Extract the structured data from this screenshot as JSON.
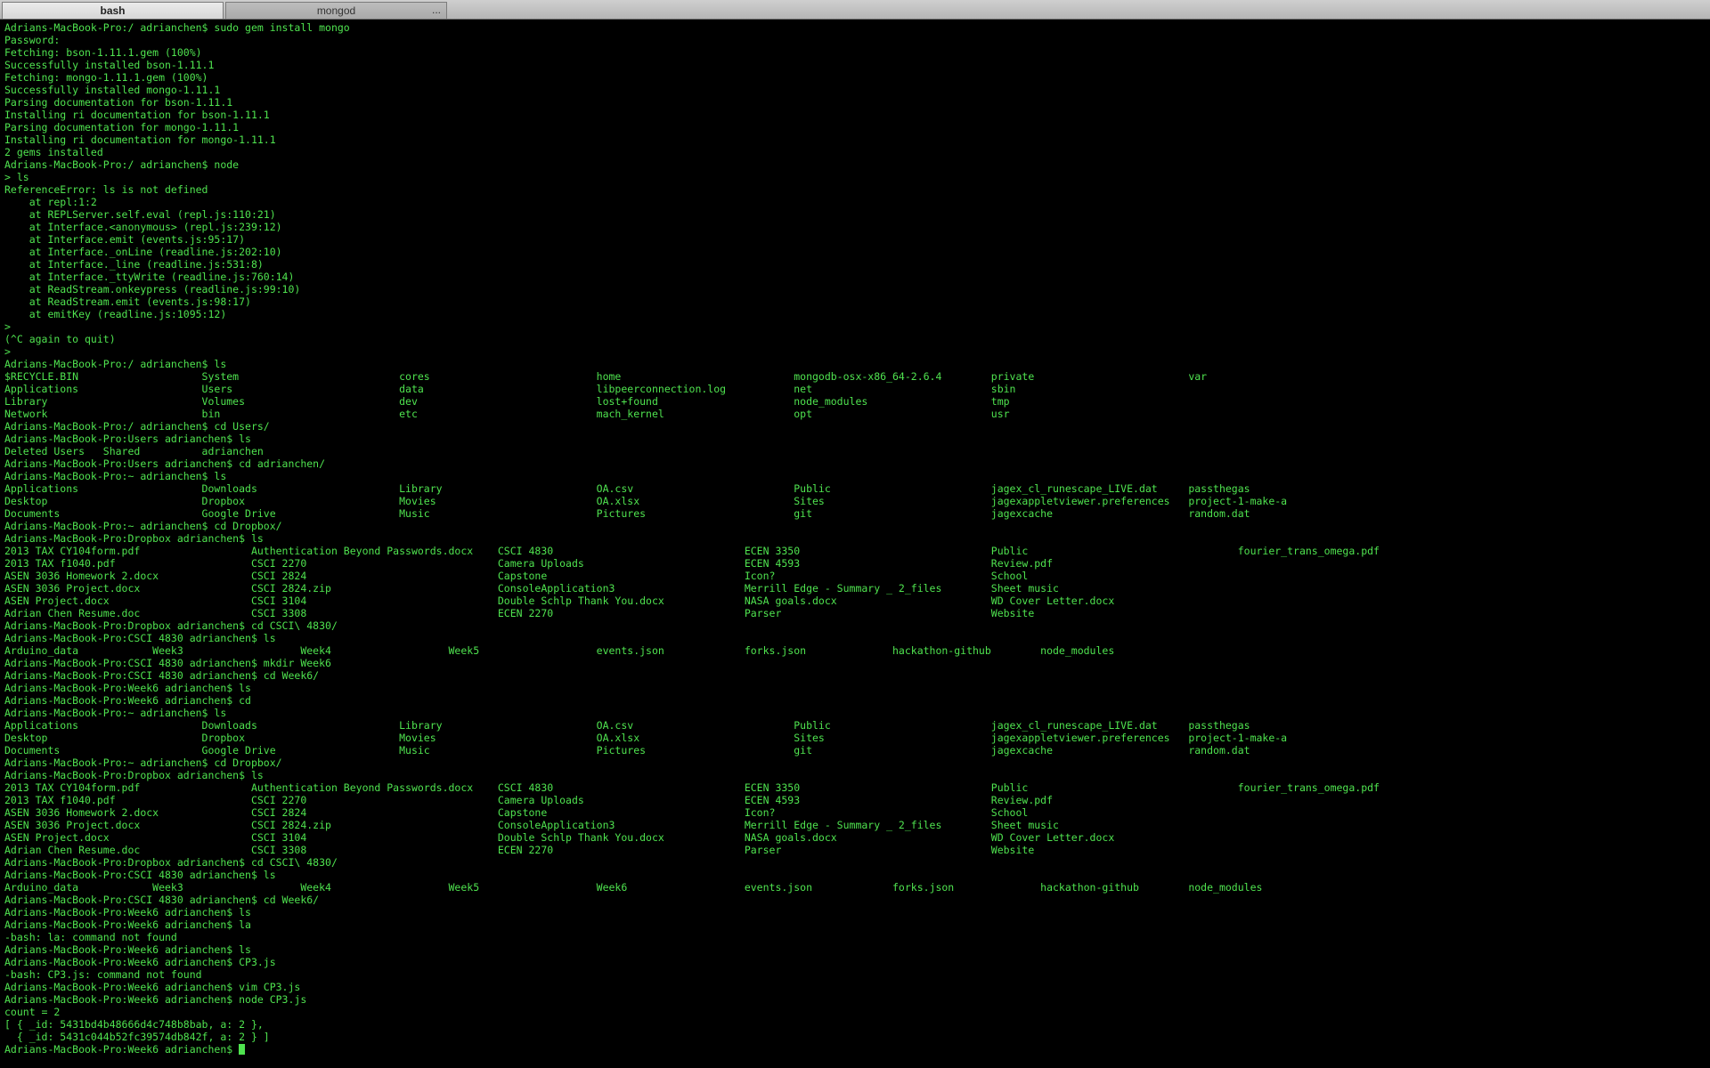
{
  "tabs": [
    {
      "label": "bash",
      "active": true
    },
    {
      "label": "mongod",
      "active": false,
      "menu": "..."
    }
  ],
  "colors": {
    "text": "#4fe34f",
    "background": "#000000"
  },
  "terminal": {
    "lines": [
      "Adrians-MacBook-Pro:/ adrianchen$ sudo gem install mongo",
      "Password:",
      "Fetching: bson-1.11.1.gem (100%)",
      "Successfully installed bson-1.11.1",
      "Fetching: mongo-1.11.1.gem (100%)",
      "Successfully installed mongo-1.11.1",
      "Parsing documentation for bson-1.11.1",
      "Installing ri documentation for bson-1.11.1",
      "Parsing documentation for mongo-1.11.1",
      "Installing ri documentation for mongo-1.11.1",
      "2 gems installed",
      "Adrians-MacBook-Pro:/ adrianchen$ node",
      "> ls",
      "ReferenceError: ls is not defined",
      "    at repl:1:2",
      "    at REPLServer.self.eval (repl.js:110:21)",
      "    at Interface.<anonymous> (repl.js:239:12)",
      "    at Interface.emit (events.js:95:17)",
      "    at Interface._onLine (readline.js:202:10)",
      "    at Interface._line (readline.js:531:8)",
      "    at Interface._ttyWrite (readline.js:760:14)",
      "    at ReadStream.onkeypress (readline.js:99:10)",
      "    at ReadStream.emit (events.js:98:17)",
      "    at emitKey (readline.js:1095:12)",
      ">",
      "(^C again to quit)",
      ">",
      "Adrians-MacBook-Pro:/ adrianchen$ ls",
      "$RECYCLE.BIN                    System                          cores                           home                            mongodb-osx-x86_64-2.6.4        private                         var",
      "Applications                    Users                           data                            libpeerconnection.log           net                             sbin",
      "Library                         Volumes                         dev                             lost+found                      node_modules                    tmp",
      "Network                         bin                             etc                             mach_kernel                     opt                             usr",
      "Adrians-MacBook-Pro:/ adrianchen$ cd Users/",
      "Adrians-MacBook-Pro:Users adrianchen$ ls",
      "Deleted Users   Shared          adrianchen",
      "Adrians-MacBook-Pro:Users adrianchen$ cd adrianchen/",
      "Adrians-MacBook-Pro:~ adrianchen$ ls",
      "Applications                    Downloads                       Library                         OA.csv                          Public                          jagex_cl_runescape_LIVE.dat     passthegas",
      "Desktop                         Dropbox                         Movies                          OA.xlsx                         Sites                           jagexappletviewer.preferences   project-1-make-a",
      "Documents                       Google Drive                    Music                           Pictures                        git                             jagexcache                      random.dat",
      "Adrians-MacBook-Pro:~ adrianchen$ cd Dropbox/",
      "Adrians-MacBook-Pro:Dropbox adrianchen$ ls",
      "2013 TAX CY104form.pdf                  Authentication Beyond Passwords.docx    CSCI 4830                               ECEN 3350                               Public                                  fourier_trans_omega.pdf",
      "2013 TAX f1040.pdf                      CSCI 2270                               Camera Uploads                          ECEN 4593                               Review.pdf",
      "ASEN 3036 Homework 2.docx               CSCI 2824                               Capstone                                Icon?                                   School",
      "ASEN 3036 Project.docx                  CSCI 2824.zip                           ConsoleApplication3                     Merrill Edge - Summary _ 2_files        Sheet music",
      "ASEN Project.docx                       CSCI 3104                               Double Schlp Thank You.docx             NASA goals.docx                         WD Cover Letter.docx",
      "Adrian Chen Resume.doc                  CSCI 3308                               ECEN 2270                               Parser                                  Website",
      "Adrians-MacBook-Pro:Dropbox adrianchen$ cd CSCI\\ 4830/",
      "Adrians-MacBook-Pro:CSCI 4830 adrianchen$ ls",
      "Arduino_data            Week3                   Week4                   Week5                   events.json             forks.json              hackathon-github        node_modules",
      "Adrians-MacBook-Pro:CSCI 4830 adrianchen$ mkdir Week6",
      "Adrians-MacBook-Pro:CSCI 4830 adrianchen$ cd Week6/",
      "Adrians-MacBook-Pro:Week6 adrianchen$ ls",
      "Adrians-MacBook-Pro:Week6 adrianchen$ cd",
      "Adrians-MacBook-Pro:~ adrianchen$ ls",
      "Applications                    Downloads                       Library                         OA.csv                          Public                          jagex_cl_runescape_LIVE.dat     passthegas",
      "Desktop                         Dropbox                         Movies                          OA.xlsx                         Sites                           jagexappletviewer.preferences   project-1-make-a",
      "Documents                       Google Drive                    Music                           Pictures                        git                             jagexcache                      random.dat",
      "Adrians-MacBook-Pro:~ adrianchen$ cd Dropbox/",
      "Adrians-MacBook-Pro:Dropbox adrianchen$ ls",
      "2013 TAX CY104form.pdf                  Authentication Beyond Passwords.docx    CSCI 4830                               ECEN 3350                               Public                                  fourier_trans_omega.pdf",
      "2013 TAX f1040.pdf                      CSCI 2270                               Camera Uploads                          ECEN 4593                               Review.pdf",
      "ASEN 3036 Homework 2.docx               CSCI 2824                               Capstone                                Icon?                                   School",
      "ASEN 3036 Project.docx                  CSCI 2824.zip                           ConsoleApplication3                     Merrill Edge - Summary _ 2_files        Sheet music",
      "ASEN Project.docx                       CSCI 3104                               Double Schlp Thank You.docx             NASA goals.docx                         WD Cover Letter.docx",
      "Adrian Chen Resume.doc                  CSCI 3308                               ECEN 2270                               Parser                                  Website",
      "Adrians-MacBook-Pro:Dropbox adrianchen$ cd CSCI\\ 4830/",
      "Adrians-MacBook-Pro:CSCI 4830 adrianchen$ ls",
      "Arduino_data            Week3                   Week4                   Week5                   Week6                   events.json             forks.json              hackathon-github        node_modules",
      "Adrians-MacBook-Pro:CSCI 4830 adrianchen$ cd Week6/",
      "Adrians-MacBook-Pro:Week6 adrianchen$ ls",
      "Adrians-MacBook-Pro:Week6 adrianchen$ la",
      "-bash: la: command not found",
      "Adrians-MacBook-Pro:Week6 adrianchen$ ls",
      "Adrians-MacBook-Pro:Week6 adrianchen$ CP3.js",
      "-bash: CP3.js: command not found",
      "Adrians-MacBook-Pro:Week6 adrianchen$ vim CP3.js",
      "Adrians-MacBook-Pro:Week6 adrianchen$ node CP3.js",
      "count = 2",
      "[ { _id: 5431bd4b48666d4c748b8bab, a: 2 },",
      "  { _id: 5431c044b52fc39574db842f, a: 2 } ]"
    ],
    "prompt": "Adrians-MacBook-Pro:Week6 adrianchen$ "
  }
}
